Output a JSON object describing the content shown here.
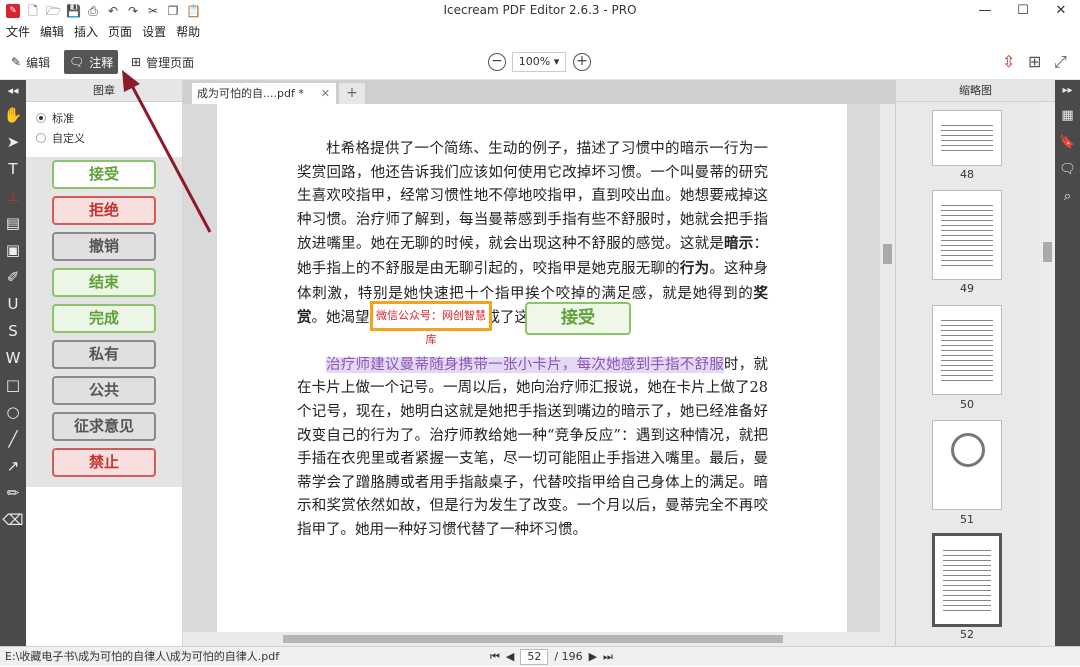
{
  "window": {
    "title": "Icecream PDF Editor 2.6.3 - PRO",
    "controls": [
      "—",
      "☐",
      "✕"
    ]
  },
  "menu": [
    "文件",
    "编辑",
    "插入",
    "页面",
    "设置",
    "帮助"
  ],
  "toolbar": {
    "edit_label": "编辑",
    "annotate_label": "注释",
    "manage_pages_label": "管理页面",
    "zoom": "100%"
  },
  "stamp_panel": {
    "title": "图章",
    "options": [
      {
        "label": "标准",
        "selected": true
      },
      {
        "label": "自定义",
        "selected": false
      }
    ],
    "stamps": [
      {
        "label": "接受",
        "color": "green",
        "selected": true
      },
      {
        "label": "拒绝",
        "color": "red",
        "selected": false
      },
      {
        "label": "撤销",
        "color": "gray",
        "selected": false
      },
      {
        "label": "结束",
        "color": "green",
        "selected": false
      },
      {
        "label": "完成",
        "color": "green",
        "selected": false
      },
      {
        "label": "私有",
        "color": "gray",
        "selected": false
      },
      {
        "label": "公共",
        "color": "gray",
        "selected": false
      },
      {
        "label": "征求意见",
        "color": "gray",
        "selected": false
      },
      {
        "label": "禁止",
        "color": "red",
        "selected": false
      }
    ]
  },
  "document": {
    "tab_title": "成为可怕的自....pdf *",
    "paragraph1": "杜希格提供了一个简练、生动的例子，描述了习惯中的暗示一行为一奖赏回路，他还告诉我们应该如何使用它改掉坏习惯。一个叫曼蒂的研究生喜欢咬指甲，经常习惯性地不停地咬指甲，直到咬出血。她想要戒掉这种习惯。治疗师了解到，每当曼蒂感到手指有些不舒服时，她就会把手指放进嘴里。她在无聊的时候，就会出现这种不舒服的感觉。这就是",
    "bold1": "暗示",
    "paragraph1b": "：她手指上的不舒服是由无聊引起的，咬指甲是她克服无聊的",
    "bold2": "行为",
    "paragraph1c": "。这种身体刺激，特别是她快速把十个指甲挨个咬掉的满足感，就是她得到的",
    "bold3": "奖赏",
    "paragraph1d": "。她渴望这种奖赏，结果养成了这种习惯。",
    "watermark_label": "微信公众号：网创智慧库",
    "placed_stamp": "接受",
    "paragraph2_highlight": "治疗师建议曼蒂随身携带一张小卡片，每次她感到手指不舒服",
    "paragraph2": "时，就在卡片上做一个记号。一周以后，她向治疗师汇报说，她在卡片上做了28个记号，现在，她明白这就是她把手指送到嘴边的暗示了，她已经准备好改变自己的行为了。治疗师教给她一种“竞争反应”：遇到这种情况，就把手插在衣兜里或者紧握一支笔，尽一切可能阻止手指进入嘴里。最后，曼蒂学会了蹭胳膊或者用手指敲桌子，代替咬指甲给自己身体上的满足。暗示和奖赏依然如故，但是行为发生了改变。一个月以后，曼蒂完全不再咬指甲了。她用一种好习惯代替了一种坏习惯。"
  },
  "thumbnails": {
    "title": "缩略图",
    "pages": [
      "48",
      "49",
      "50",
      "51",
      "52"
    ]
  },
  "status": {
    "path": "E:\\收藏电子书\\成为可怕的自律人\\成为可怕的自律人.pdf",
    "current_page": "52",
    "total_pages": "/ 196"
  }
}
